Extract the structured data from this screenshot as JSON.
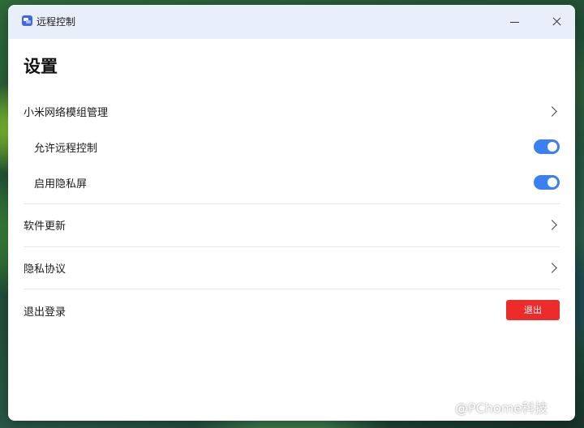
{
  "window": {
    "title": "远程控制",
    "controls": {
      "minimize_icon": "minimize-icon",
      "close_icon": "close-icon"
    }
  },
  "page": {
    "title": "设置"
  },
  "settings": {
    "module_management": {
      "label": "小米网络模组管理",
      "icon": "chevron-right-icon"
    },
    "allow_remote_control": {
      "label": "允许远程控制",
      "enabled": true
    },
    "privacy_screen": {
      "label": "启用隐私屏",
      "enabled": true
    },
    "software_update": {
      "label": "软件更新",
      "icon": "chevron-right-icon"
    },
    "privacy_policy": {
      "label": "隐私协议",
      "icon": "chevron-right-icon"
    },
    "logout": {
      "label": "退出登录",
      "button_label": "退出"
    }
  },
  "watermark": {
    "text": "@PChome科技"
  },
  "colors": {
    "titlebar_bg": "#e9eefb",
    "toggle_on": "#3b7ff0",
    "logout_button": "#ee2b2b",
    "accent_icon": "#3f66e8"
  }
}
